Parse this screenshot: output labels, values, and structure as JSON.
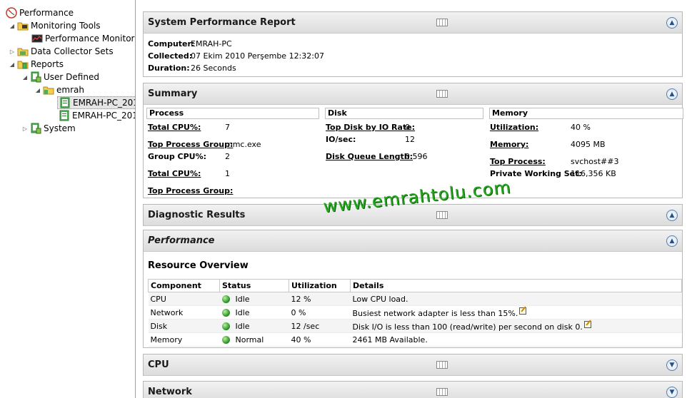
{
  "tree": {
    "root": "Performance",
    "monitoring_tools": "Monitoring Tools",
    "performance_monitor": "Performance Monitor",
    "data_collector_sets": "Data Collector Sets",
    "reports": "Reports",
    "user_defined": "User Defined",
    "emrah": "emrah",
    "report1": "EMRAH-PC_201",
    "report2": "EMRAH-PC_201",
    "system": "System"
  },
  "report_header": {
    "title": "System Performance Report",
    "computer_label": "Computer:",
    "computer_value": "EMRAH-PC",
    "collected_label": "Collected:",
    "collected_value": "07 Ekim 2010 Perşembe 12:32:07",
    "duration_label": "Duration:",
    "duration_value": "26 Seconds"
  },
  "summary": {
    "title": "Summary",
    "process": {
      "header": "Process",
      "total_cpu_label": "Total CPU%:",
      "total_cpu_value": "7",
      "top_process_group_label": "Top Process Group:",
      "top_process_group_value": "mmc.exe",
      "group_cpu_label": "Group CPU%:",
      "group_cpu_value": "2",
      "total_cpu2_label": "Total CPU%:",
      "total_cpu2_value": "1",
      "top_process_group2_label": "Top Process Group:"
    },
    "disk": {
      "header": "Disk",
      "top_disk_label": "Top Disk by IO Rate:",
      "top_disk_value": "0",
      "io_label": "IO/sec:",
      "io_value": "12",
      "queue_label": "Disk Queue Length:",
      "queue_value": "0.596"
    },
    "memory": {
      "header": "Memory",
      "utilization_label": "Utilization:",
      "utilization_value": "40 %",
      "memory_label": "Memory:",
      "memory_value": "4095 MB",
      "top_process_label": "Top Process:",
      "top_process_value": "svchost##3",
      "pws_label": "Private Working Set:",
      "pws_value": "116,356 KB"
    }
  },
  "diagnostic": {
    "title": "Diagnostic Results"
  },
  "performance": {
    "title": "Performance",
    "resource_overview": "Resource Overview",
    "columns": [
      "Component",
      "Status",
      "Utilization",
      "Details"
    ],
    "rows": [
      {
        "component": "CPU",
        "status": "Idle",
        "utilization": "12 %",
        "details": "Low CPU load.",
        "edit": false
      },
      {
        "component": "Network",
        "status": "Idle",
        "utilization": "0 %",
        "details": "Busiest network adapter is less than 15%.",
        "edit": true
      },
      {
        "component": "Disk",
        "status": "Idle",
        "utilization": "12 /sec",
        "details": "Disk I/O is less than 100 (read/write) per second on disk 0.",
        "edit": true
      },
      {
        "component": "Memory",
        "status": "Normal",
        "utilization": "40 %",
        "details": "2461 MB Available.",
        "edit": false
      }
    ]
  },
  "cpu": {
    "title": "CPU"
  },
  "network": {
    "title": "Network"
  },
  "watermark": "www.emrahtolu.com",
  "colors": {
    "status_ok": "#1f8a1f",
    "watermark": "#23a81e"
  }
}
